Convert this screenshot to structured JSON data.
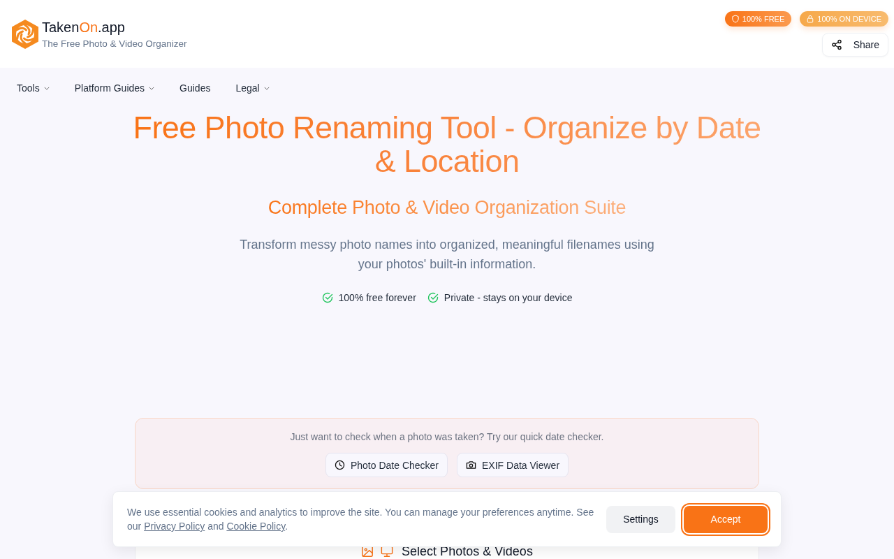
{
  "header": {
    "brand": [
      {
        "text": "Taken",
        "accent": false
      },
      {
        "text": "On",
        "accent": true
      },
      {
        "text": ".app",
        "accent": false
      }
    ],
    "tagline": "The Free Photo & Video Organizer",
    "badges": [
      {
        "label": "100% FREE",
        "kind": "free"
      },
      {
        "label": "100% ON DEVICE",
        "kind": "device"
      }
    ],
    "share_button": {
      "label": "Share"
    }
  },
  "nav": [
    {
      "label": "Tools",
      "has_menu": true
    },
    {
      "label": "Platform Guides",
      "has_menu": true
    },
    {
      "label": "Guides",
      "has_menu": false
    },
    {
      "label": "Legal",
      "has_menu": true
    }
  ],
  "hero": {
    "title": "Free Photo Renaming Tool - Organize by Date & Location",
    "subtitle": "Complete Photo & Video Organization Suite",
    "description": "Transform messy photo names into organized, meaningful filenames using your photos' built-in information.",
    "features": [
      "100% free forever",
      "Private - stays on your device"
    ]
  },
  "quick_check": {
    "prompt": "Just want to check when a photo was taken? Try our quick date checker.",
    "buttons": [
      {
        "label": "Photo Date Checker",
        "kind": "clock"
      },
      {
        "label": "EXIF Data Viewer",
        "kind": "camera"
      }
    ]
  },
  "upload": {
    "title": "Select Photos & Videos"
  },
  "cookie_banner": {
    "message": [
      {
        "text": "We use essential cookies and analytics to improve the site. You can manage your preferences anytime. See our ",
        "kind": "text"
      },
      {
        "text": "Privacy Policy",
        "kind": "link"
      },
      {
        "text": " and ",
        "kind": "text"
      },
      {
        "text": "Cookie Policy",
        "kind": "link"
      },
      {
        "text": ".",
        "kind": "text"
      }
    ],
    "buttons": [
      {
        "label": "Settings",
        "kind": "secondary",
        "focused": false
      },
      {
        "label": "Accept",
        "kind": "primary",
        "focused": true
      }
    ]
  }
}
